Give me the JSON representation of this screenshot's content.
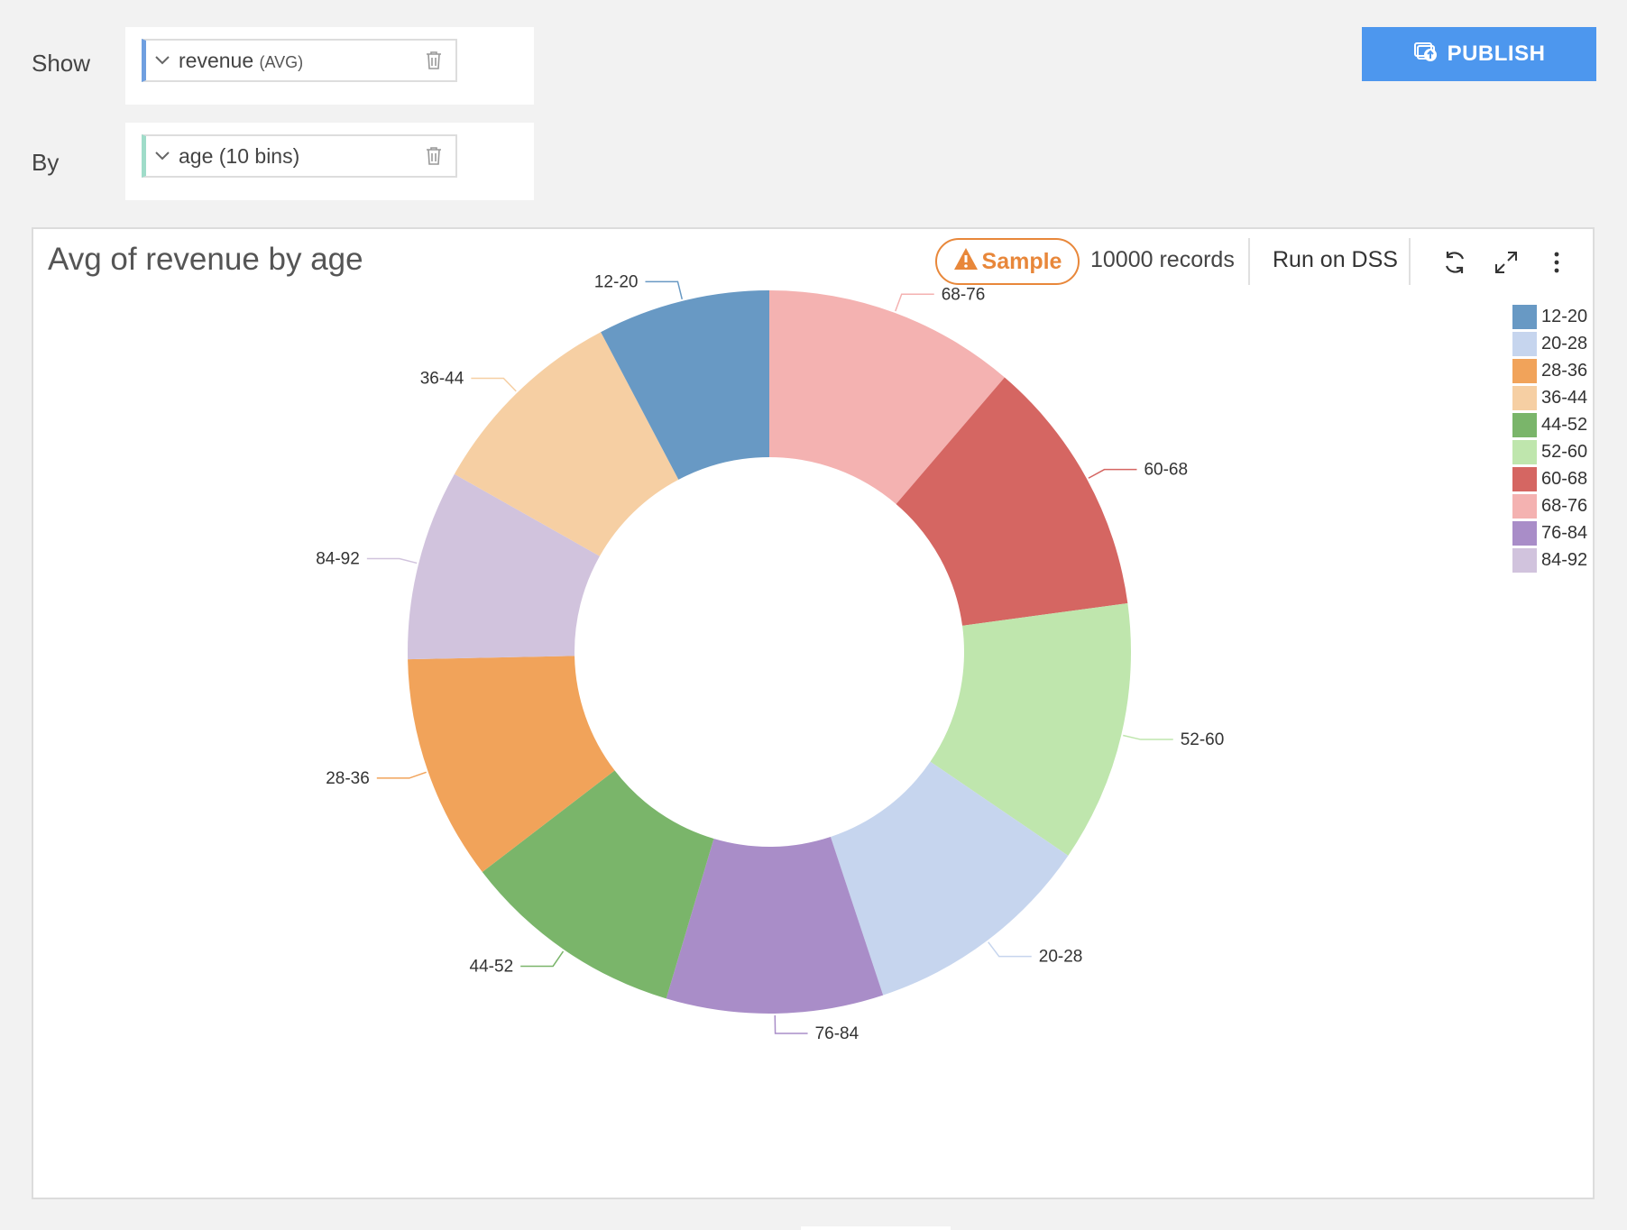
{
  "shelf": {
    "show_label": "Show",
    "by_label": "By",
    "show_pill": {
      "field": "revenue",
      "agg": "(AVG)",
      "accent": "#6f9fe0"
    },
    "by_pill": {
      "text": "age (10 bins)",
      "accent": "#9fdcc9"
    }
  },
  "toolbar": {
    "publish_label": "PUBLISH",
    "publish_color": "#4d97ee"
  },
  "chart_header": {
    "title": "Avg of revenue by age",
    "sample_label": "Sample",
    "records": "10000 records",
    "run_on_dss": "Run on DSS",
    "icons": [
      "refresh-icon",
      "expand-icon",
      "more-vertical-icon"
    ]
  },
  "chart_data": {
    "type": "pie",
    "variant": "donut",
    "title": "Avg of revenue by age",
    "categories": [
      "12-20",
      "20-28",
      "28-36",
      "36-44",
      "44-52",
      "52-60",
      "60-68",
      "68-76",
      "76-84",
      "84-92"
    ],
    "values": [
      7.8,
      10.5,
      10.2,
      9.2,
      10.1,
      11.8,
      11.7,
      11.4,
      9.8,
      8.6
    ],
    "drawing_order": [
      "68-76",
      "60-68",
      "52-60",
      "20-28",
      "76-84",
      "44-52",
      "28-36",
      "84-92",
      "36-44",
      "12-20"
    ],
    "colors": {
      "12-20": "#6899c4",
      "20-28": "#c6d5ee",
      "28-36": "#f1a35a",
      "36-44": "#f6cfa3",
      "44-52": "#7ab56a",
      "52-60": "#bfe6ad",
      "60-68": "#d56662",
      "68-76": "#f4b2b1",
      "76-84": "#a98dc8",
      "84-92": "#d1c3dd"
    },
    "legend": [
      "12-20",
      "20-28",
      "28-36",
      "36-44",
      "44-52",
      "52-60",
      "60-68",
      "68-76",
      "76-84",
      "84-92"
    ],
    "legend_position": "top-right"
  }
}
